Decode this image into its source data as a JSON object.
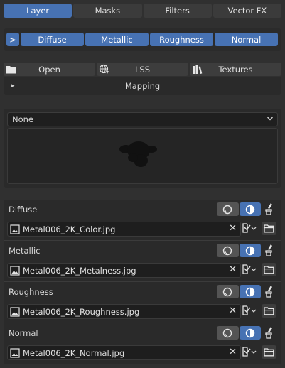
{
  "tabs": [
    "Layer",
    "Masks",
    "Filters",
    "Vector FX"
  ],
  "active_tab": "Layer",
  "channels": [
    "Diffuse",
    "Metallic",
    "Roughness",
    "Normal"
  ],
  "channel_expander": ">",
  "tools": {
    "open": "Open",
    "lss": "LSS",
    "textures": "Textures"
  },
  "mapping": {
    "label": "Mapping",
    "arrow": "▸"
  },
  "preview": {
    "select_value": "None"
  },
  "textures": [
    {
      "name": "Diffuse",
      "file": "Metal006_2K_Color.jpg"
    },
    {
      "name": "Metallic",
      "file": "Metal006_2K_Metalness.jpg"
    },
    {
      "name": "Roughness",
      "file": "Metal006_2K_Roughness.jpg"
    },
    {
      "name": "Normal",
      "file": "Metal006_2K_Normal.jpg"
    }
  ],
  "clear_symbol": "✕",
  "colors": {
    "accent": "#4772b3",
    "background": "#303030",
    "panel": "#2a2a2a"
  }
}
